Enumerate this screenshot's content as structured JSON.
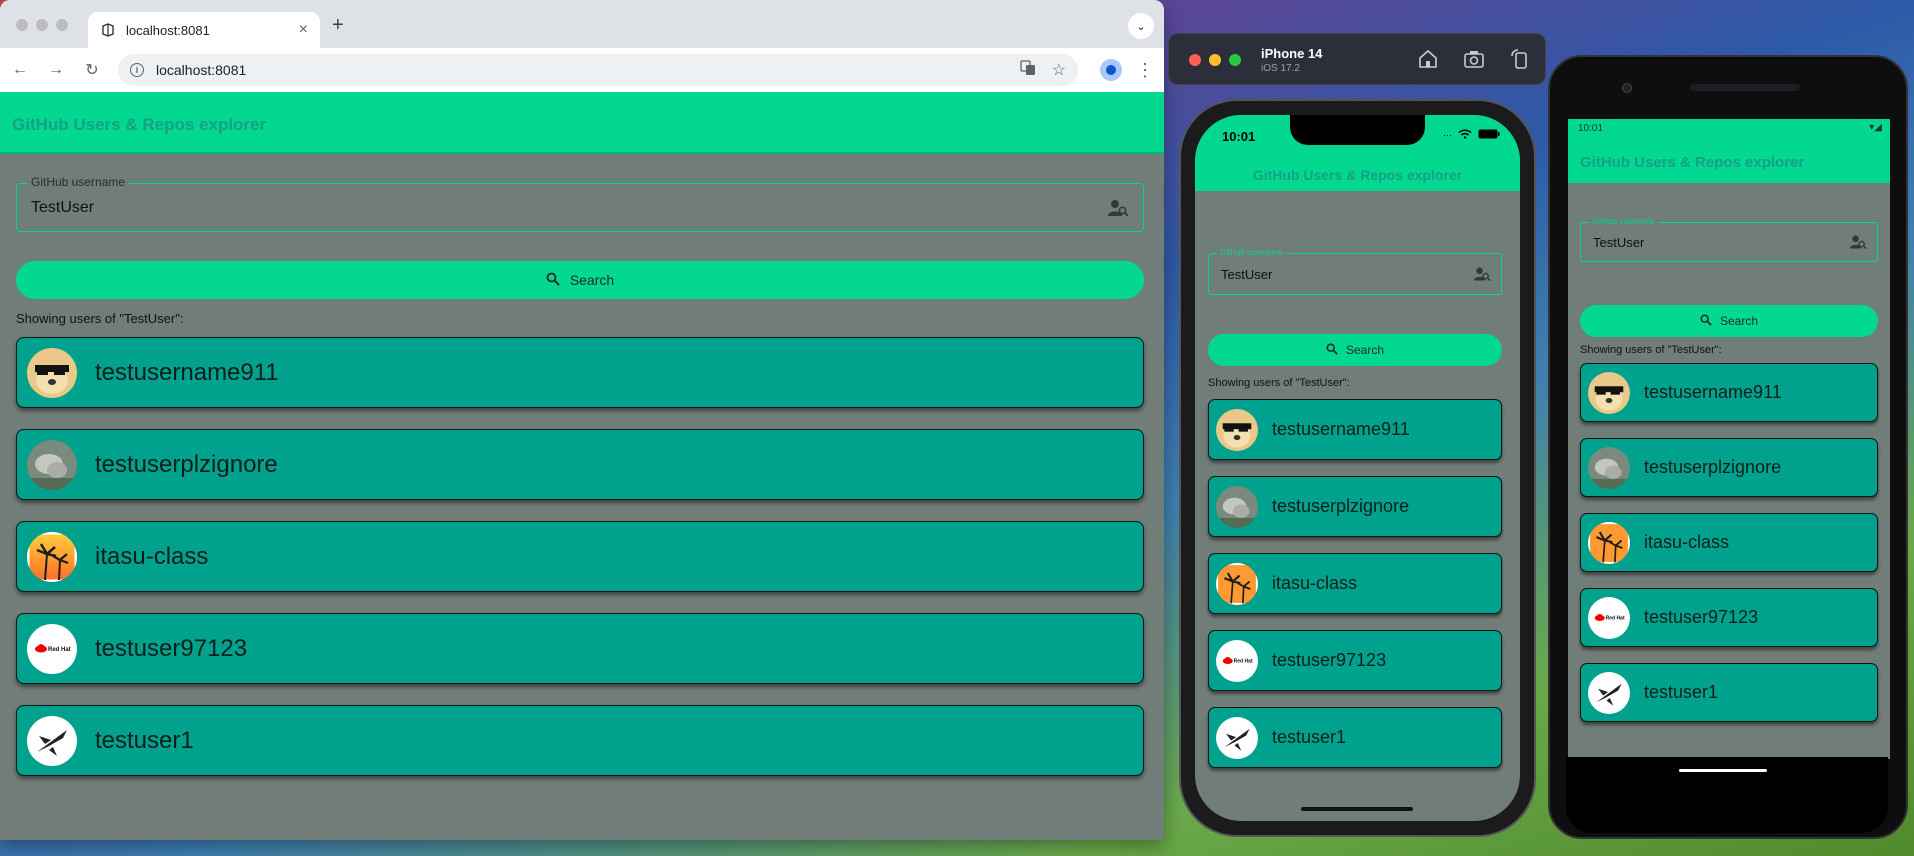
{
  "browser": {
    "tab_title": "localhost:8081",
    "tab_close": "×",
    "new_tab": "+",
    "tabs_menu": "⌄",
    "url": "localhost:8081"
  },
  "app": {
    "title": "GitHub Users & Repos explorer",
    "field_label": "GitHub username",
    "field_value": "TestUser",
    "search_label": "Search",
    "showing_text": "Showing users of \"TestUser\":",
    "users": [
      {
        "name": "testusername911",
        "avatar": "doge-avatar"
      },
      {
        "name": "testuserplzignore",
        "avatar": "gray-photo-avatar"
      },
      {
        "name": "itasu-class",
        "avatar": "palm-sunset-avatar"
      },
      {
        "name": "testuser97123",
        "avatar": "redhat-avatar"
      },
      {
        "name": "testuser1",
        "avatar": "jet-avatar"
      }
    ]
  },
  "simulator": {
    "device": "iPhone 14",
    "os": "iOS 17.2",
    "time": "10:01"
  },
  "android": {
    "time": "10:01"
  },
  "colors": {
    "accent": "#02d88f",
    "card": "#00a18d",
    "background": "#707d78",
    "title": "#16a086"
  }
}
